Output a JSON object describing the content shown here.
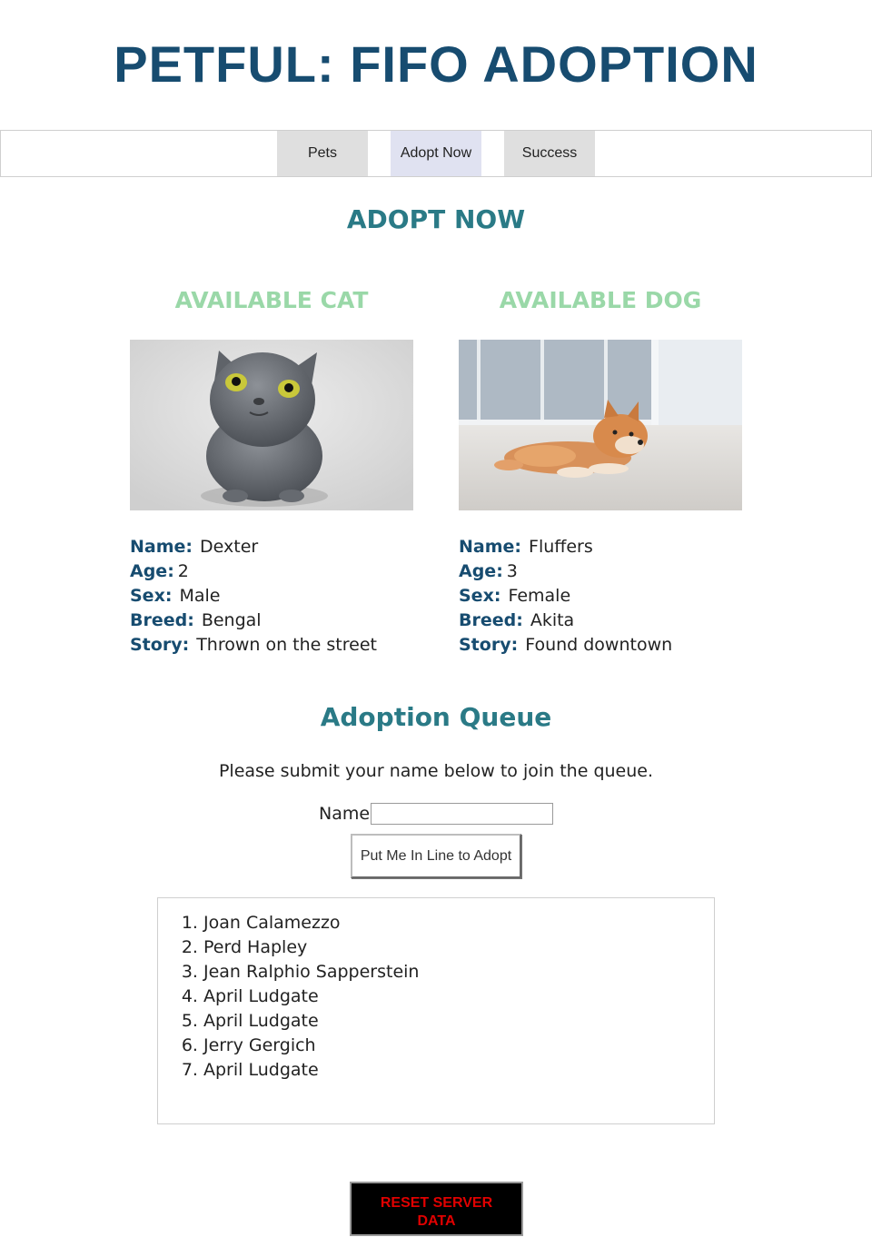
{
  "header": {
    "title": "PETFUL: FIFO ADOPTION"
  },
  "nav": {
    "items": [
      {
        "label": "Pets",
        "active": false
      },
      {
        "label": "Adopt Now",
        "active": true
      },
      {
        "label": "Success",
        "active": false
      }
    ]
  },
  "page": {
    "heading": "ADOPT NOW"
  },
  "labels": {
    "name": "Name:",
    "age": "Age:",
    "sex": "Sex:",
    "breed": "Breed:",
    "story": "Story:"
  },
  "cat": {
    "heading": "AVAILABLE CAT",
    "photo": "gray cat looking up",
    "name": "Dexter",
    "age": "2",
    "sex": "Male",
    "breed": "Bengal",
    "story": "Thrown on the street"
  },
  "dog": {
    "heading": "AVAILABLE DOG",
    "photo": "akita puppy lying on rug",
    "name": "Fluffers",
    "age": "3",
    "sex": "Female",
    "breed": "Akita",
    "story": "Found downtown"
  },
  "queue": {
    "heading": "Adoption Queue",
    "intro": "Please submit your name below to join the queue.",
    "name_label": "Name:",
    "name_value": "",
    "button_label": "Put Me In Line to Adopt",
    "people": [
      "Joan Calamezzo",
      "Perd Hapley",
      "Jean Ralphio Sapperstein",
      "April Ludgate",
      "April Ludgate",
      "Jerry Gergich",
      "April Ludgate"
    ]
  },
  "reset": {
    "label": "RESET SERVER DATA"
  },
  "colors": {
    "title": "#174c70",
    "heading": "#2a7a86",
    "pet_heading": "#9ad8a8",
    "reset_text": "#e00000"
  }
}
